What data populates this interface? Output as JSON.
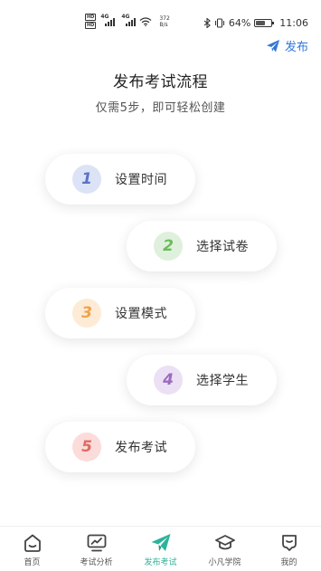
{
  "status_bar": {
    "network_speed_value": "372",
    "network_speed_unit": "B/s",
    "battery_percent": "64%",
    "battery_level": 0.64,
    "time": "11:06"
  },
  "header": {
    "publish_label": "发布"
  },
  "intro": {
    "title": "发布考试流程",
    "subtitle": "仅需5步，即可轻松创建"
  },
  "steps": [
    {
      "number": "1",
      "label": "设置时间",
      "color": "#5a72c8",
      "bg": "#dde3f6"
    },
    {
      "number": "2",
      "label": "选择试卷",
      "color": "#6dba5e",
      "bg": "#dff0dc"
    },
    {
      "number": "3",
      "label": "设置模式",
      "color": "#f0a24a",
      "bg": "#fdebd6"
    },
    {
      "number": "4",
      "label": "选择学生",
      "color": "#9a6cc0",
      "bg": "#ece0f4"
    },
    {
      "number": "5",
      "label": "发布考试",
      "color": "#e06a62",
      "bg": "#fbdcda"
    }
  ],
  "bottom_nav": [
    {
      "label": "首页",
      "icon": "home-icon"
    },
    {
      "label": "考试分析",
      "icon": "analysis-icon"
    },
    {
      "label": "发布考试",
      "icon": "paper-plane-icon",
      "active": true
    },
    {
      "label": "小凡学院",
      "icon": "graduation-cap-icon"
    },
    {
      "label": "我的",
      "icon": "profile-icon"
    }
  ],
  "colors": {
    "accent_blue": "#2f76d8",
    "accent_green": "#2bb39b"
  }
}
